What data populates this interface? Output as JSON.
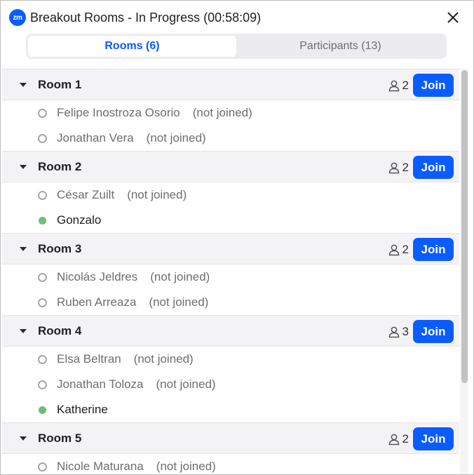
{
  "window": {
    "title": "Breakout Rooms - In Progress (00:58:09)",
    "logo_text": "zm"
  },
  "tabs": [
    {
      "label": "Rooms (6)",
      "active": true
    },
    {
      "label": "Participants (13)",
      "active": false
    }
  ],
  "rooms": [
    {
      "name": "Room 1",
      "count": "2",
      "join_label": "Join",
      "participants": [
        {
          "name": "Felipe Inostroza Osorio",
          "state": "(not joined)",
          "joined": false
        },
        {
          "name": "Jonathan Vera",
          "state": "(not joined)",
          "joined": false
        }
      ]
    },
    {
      "name": "Room 2",
      "count": "2",
      "join_label": "Join",
      "participants": [
        {
          "name": "César Zuilt",
          "state": "(not joined)",
          "joined": false
        },
        {
          "name": "Gonzalo",
          "state": "",
          "joined": true
        }
      ]
    },
    {
      "name": "Room 3",
      "count": "2",
      "join_label": "Join",
      "participants": [
        {
          "name": "Nicolás Jeldres",
          "state": "(not joined)",
          "joined": false
        },
        {
          "name": "Ruben Arreaza",
          "state": "(not joined)",
          "joined": false
        }
      ]
    },
    {
      "name": "Room 4",
      "count": "3",
      "join_label": "Join",
      "participants": [
        {
          "name": "Elsa Beltran",
          "state": "(not joined)",
          "joined": false
        },
        {
          "name": "Jonathan Toloza",
          "state": "(not joined)",
          "joined": false
        },
        {
          "name": "Katherine",
          "state": "",
          "joined": true
        }
      ]
    },
    {
      "name": "Room 5",
      "count": "2",
      "join_label": "Join",
      "participants": [
        {
          "name": "Nicole Maturana",
          "state": "(not joined)",
          "joined": false
        }
      ]
    }
  ],
  "colors": {
    "accent": "#0b5cff",
    "joined_dot": "#6ebf74",
    "not_joined_ring": "#a6a6a6"
  },
  "icons": {
    "close": "close-icon",
    "caret": "caret-down-icon",
    "people": "person-icon"
  }
}
